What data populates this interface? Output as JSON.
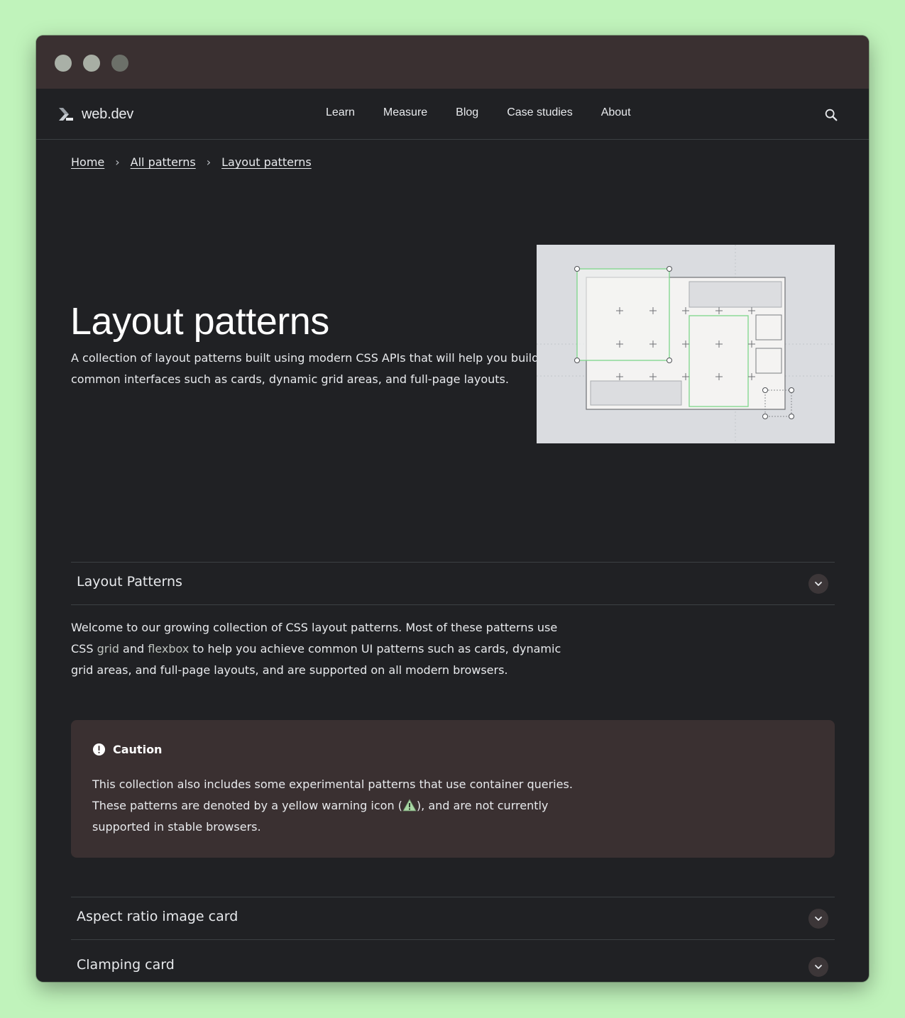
{
  "site": {
    "logo_text": "web.dev",
    "nav": [
      "Learn",
      "Measure",
      "Blog",
      "Case studies",
      "About"
    ]
  },
  "breadcrumb": [
    "Home",
    "All patterns",
    "Layout patterns"
  ],
  "hero": {
    "title": "Layout patterns",
    "description": "A collection of layout patterns built using modern CSS APIs that will help you build common interfaces such as cards, dynamic grid areas, and full-page layouts."
  },
  "sections": {
    "layout_patterns_label": "Layout Patterns",
    "aspect_ratio_label": "Aspect ratio image card",
    "clamping_label": "Clamping card"
  },
  "intro": {
    "part1": "Welcome to our growing collection of CSS layout patterns. Most of these patterns use CSS ",
    "link_grid": "grid",
    "part2": " and ",
    "link_flexbox": "flexbox",
    "part3": " to help you achieve common UI patterns such as cards, dynamic grid areas, and full-page layouts, and are supported on all modern browsers."
  },
  "caution": {
    "title": "Caution",
    "part1": "This collection also includes some experimental patterns that use ",
    "link": "container queries",
    "part2": ". These patterns are denoted by a yellow warning icon (",
    "part3": "), and are not currently supported in stable browsers."
  },
  "icons": {
    "search": "search-icon",
    "chevron": "chevron-down-icon",
    "caution": "exclamation-circle-icon",
    "warning": "warning-triangle-icon"
  },
  "colors": {
    "page_bg": "#c0f3bb",
    "content_bg": "#202124",
    "titlebar_bg": "#3a3031",
    "caution_bg": "#3a3031",
    "accent_green": "#7ed68b"
  }
}
